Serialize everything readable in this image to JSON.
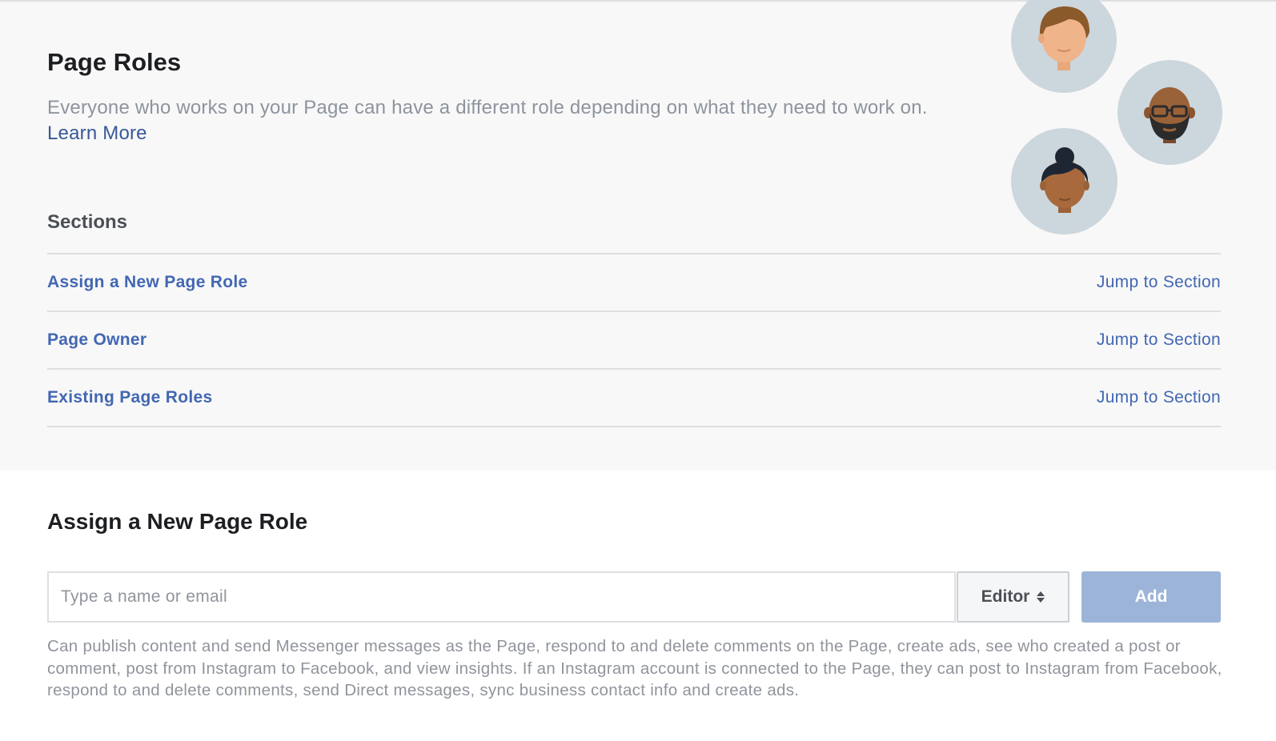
{
  "header": {
    "title": "Page Roles",
    "description": "Everyone who works on your Page can have a different role depending on what they need to work on.",
    "learn_more": "Learn More"
  },
  "avatars": [
    {
      "name": "woman-brown-hair-avatar",
      "bg": "#ccd6dd"
    },
    {
      "name": "man-beard-glasses-avatar",
      "bg": "#ccd6dd"
    },
    {
      "name": "woman-bun-avatar",
      "bg": "#ccd6dd"
    }
  ],
  "sections": {
    "heading": "Sections",
    "items": [
      {
        "label": "Assign a New Page Role",
        "action": "Jump to Section"
      },
      {
        "label": "Page Owner",
        "action": "Jump to Section"
      },
      {
        "label": "Existing Page Roles",
        "action": "Jump to Section"
      }
    ]
  },
  "assign": {
    "heading": "Assign a New Page Role",
    "input_placeholder": "Type a name or email",
    "input_value": "",
    "role_selected": "Editor",
    "add_label": "Add",
    "role_description": "Can publish content and send Messenger messages as the Page, respond to and delete comments on the Page, create ads, see who created a post or comment, post from Instagram to Facebook, and view insights. If an Instagram account is connected to the Page, they can post to Instagram from Facebook, respond to and delete comments, send Direct messages, sync business contact info and create ads."
  },
  "colors": {
    "link": "#4267b2",
    "add_button_disabled": "#9cb4d8",
    "intro_background": "#f8f8f8"
  }
}
